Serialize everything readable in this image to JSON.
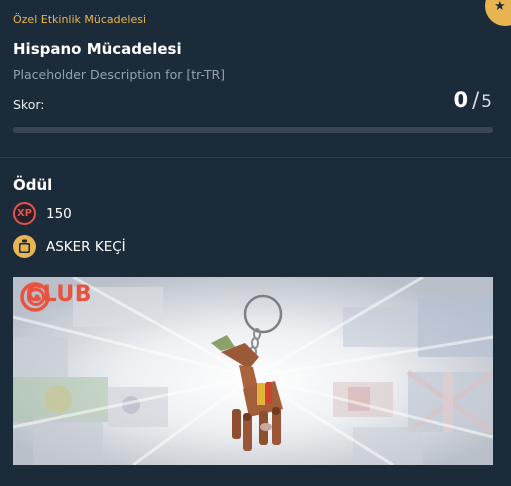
{
  "challenge": {
    "event_label": "Özel Etkinlik Mücadelesi",
    "title": "Hispano Mücadelesi",
    "description": "Placeholder Description for [tr-TR]",
    "score_label": "Skor:",
    "score_current": "0",
    "score_separator": "/",
    "score_max": "5",
    "progress_fraction": 0
  },
  "reward": {
    "title": "Ödül",
    "xp_icon_text": "XP",
    "xp_value": "150",
    "item_name": "ASKER KEÇİ",
    "banner_brand": "CLUB"
  },
  "icons": {
    "corner": "star-icon",
    "xp": "xp-icon",
    "item": "gift-icon",
    "brand": "ubisoft-swirl-icon"
  },
  "colors": {
    "background": "#1c2b3a",
    "accent_gold": "#e7b650",
    "xp_red": "#e0554e",
    "club_orange": "#e9523f",
    "muted_text": "#93a2b2"
  }
}
